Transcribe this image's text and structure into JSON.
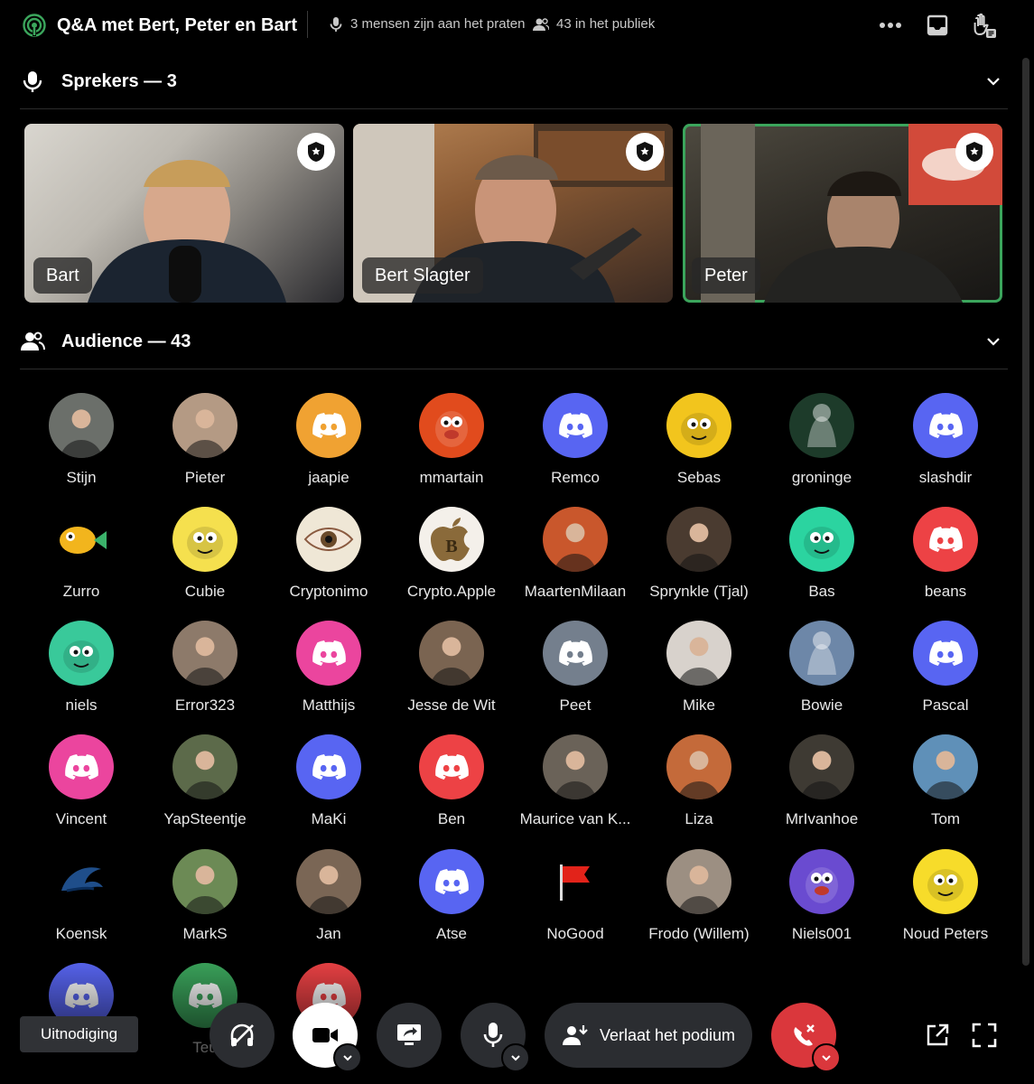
{
  "header": {
    "title": "Q&A met Bert, Peter en Bart",
    "speaking_text": "3 mensen zijn aan het praten",
    "audience_text": "43 in het publiek"
  },
  "speakers_section": {
    "title": "Sprekers — 3"
  },
  "speakers": [
    {
      "name": "Bart",
      "speaking": false
    },
    {
      "name": "Bert Slagter",
      "speaking": false
    },
    {
      "name": "Peter",
      "speaking": true
    }
  ],
  "audience_section": {
    "title": "Audience — 43"
  },
  "audience": [
    {
      "name": "Stijn",
      "avatar": "photo",
      "color": "#6b6f6a"
    },
    {
      "name": "Pieter",
      "avatar": "photo",
      "color": "#b49a84"
    },
    {
      "name": "jaapie",
      "avatar": "discord",
      "color": "#f0a232"
    },
    {
      "name": "mmartain",
      "avatar": "muppet",
      "color": "#e14b1d"
    },
    {
      "name": "Remco",
      "avatar": "discord",
      "color": "#5865f2"
    },
    {
      "name": "Sebas",
      "avatar": "cartoon",
      "color": "#f2c51d"
    },
    {
      "name": "groninge",
      "avatar": "art",
      "color": "#1d3b2a"
    },
    {
      "name": "slashdir",
      "avatar": "discord",
      "color": "#5865f2"
    },
    {
      "name": "Zurro",
      "avatar": "fish",
      "color": "#e8b21f"
    },
    {
      "name": "Cubie",
      "avatar": "cartoon",
      "color": "#f5e04e"
    },
    {
      "name": "Cryptonimo",
      "avatar": "eye",
      "color": "#efe7d6"
    },
    {
      "name": "Crypto.Apple",
      "avatar": "apple",
      "color": "#f4f0ea"
    },
    {
      "name": "MaartenMilaan",
      "avatar": "photo",
      "color": "#c9572c"
    },
    {
      "name": "Sprynkle (Tjal)",
      "avatar": "photo",
      "color": "#4a3b30"
    },
    {
      "name": "Bas",
      "avatar": "cartoon",
      "color": "#2bd4a0"
    },
    {
      "name": "beans",
      "avatar": "discord",
      "color": "#ed4245"
    },
    {
      "name": "niels",
      "avatar": "cartoon",
      "color": "#39c99a"
    },
    {
      "name": "Error323",
      "avatar": "photo",
      "color": "#8d7a6a"
    },
    {
      "name": "Matthijs",
      "avatar": "discord",
      "color": "#eb459e"
    },
    {
      "name": "Jesse de Wit",
      "avatar": "photo",
      "color": "#7a6451"
    },
    {
      "name": "Peet",
      "avatar": "discord",
      "color": "#747f8d"
    },
    {
      "name": "Mike",
      "avatar": "photo",
      "color": "#d8d2cc"
    },
    {
      "name": "Bowie",
      "avatar": "art",
      "color": "#6d87a8"
    },
    {
      "name": "Pascal",
      "avatar": "discord",
      "color": "#5865f2"
    },
    {
      "name": "Vincent",
      "avatar": "discord",
      "color": "#eb459e"
    },
    {
      "name": "YapSteentje",
      "avatar": "photo",
      "color": "#5c6a4a"
    },
    {
      "name": "MaKi",
      "avatar": "discord",
      "color": "#5865f2"
    },
    {
      "name": "Ben",
      "avatar": "discord",
      "color": "#ed4245"
    },
    {
      "name": "Maurice van K...",
      "avatar": "photo",
      "color": "#6a6258"
    },
    {
      "name": "Liza",
      "avatar": "photo",
      "color": "#c46a3a"
    },
    {
      "name": "MrIvanhoe",
      "avatar": "photo",
      "color": "#3e3a33"
    },
    {
      "name": "Tom",
      "avatar": "photo",
      "color": "#5f90b8"
    },
    {
      "name": "Koensk",
      "avatar": "orca",
      "color": "#ffffff"
    },
    {
      "name": "MarkS",
      "avatar": "photo",
      "color": "#6c8a55"
    },
    {
      "name": "Jan",
      "avatar": "photo",
      "color": "#7a6655"
    },
    {
      "name": "Atse",
      "avatar": "discord",
      "color": "#5865f2"
    },
    {
      "name": "NoGood",
      "avatar": "flag",
      "color": "#000000"
    },
    {
      "name": "Frodo (Willem)",
      "avatar": "photo",
      "color": "#9c8f82"
    },
    {
      "name": "Niels001",
      "avatar": "muppet",
      "color": "#6a4bd0"
    },
    {
      "name": "Noud Peters",
      "avatar": "cartoon",
      "color": "#f7dc2a"
    },
    {
      "name": "",
      "avatar": "discord",
      "color": "#5865f2"
    },
    {
      "name": "Teu",
      "avatar": "discord",
      "color": "#3ba55c"
    },
    {
      "name": "",
      "avatar": "discord",
      "color": "#ed4245"
    }
  ],
  "controls": {
    "leave_label": "Verlaat het podium",
    "invite_label": "Uitnodiging",
    "hangup_color": "#da373c"
  }
}
